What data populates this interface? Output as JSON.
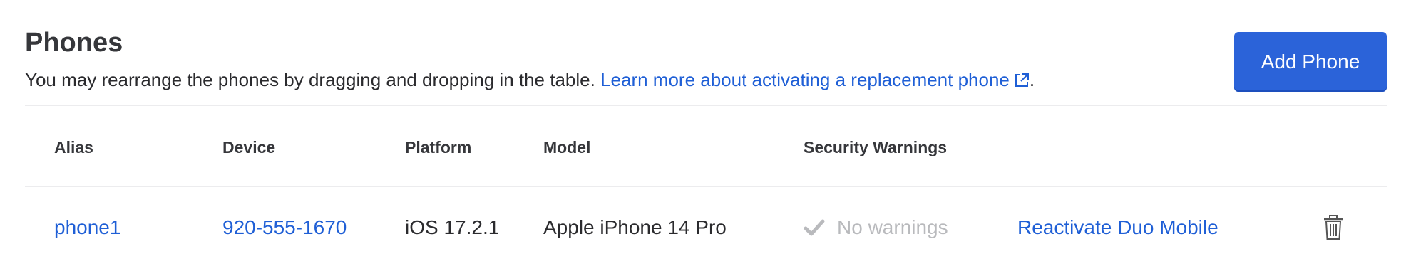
{
  "section": {
    "title": "Phones",
    "description": "You may rearrange the phones by dragging and dropping in the table.",
    "learn_more_link": "Learn more about activating a replacement phone",
    "trailing_period": ".",
    "add_button_label": "Add Phone"
  },
  "table": {
    "headers": {
      "alias": "Alias",
      "device": "Device",
      "platform": "Platform",
      "model": "Model",
      "security_warnings": "Security Warnings"
    },
    "rows": [
      {
        "alias": "phone1",
        "device": "920-555-1670",
        "platform": "iOS 17.2.1",
        "model": "Apple iPhone 14 Pro",
        "security_warning": "No warnings",
        "action": "Reactivate Duo Mobile"
      }
    ]
  },
  "icons": {
    "external_link": "external-link-icon",
    "check": "checkmark-icon",
    "delete": "trash-icon"
  },
  "colors": {
    "link": "#1f5fd6",
    "primary_button": "#2b63d9",
    "muted_text": "#b9babd"
  }
}
